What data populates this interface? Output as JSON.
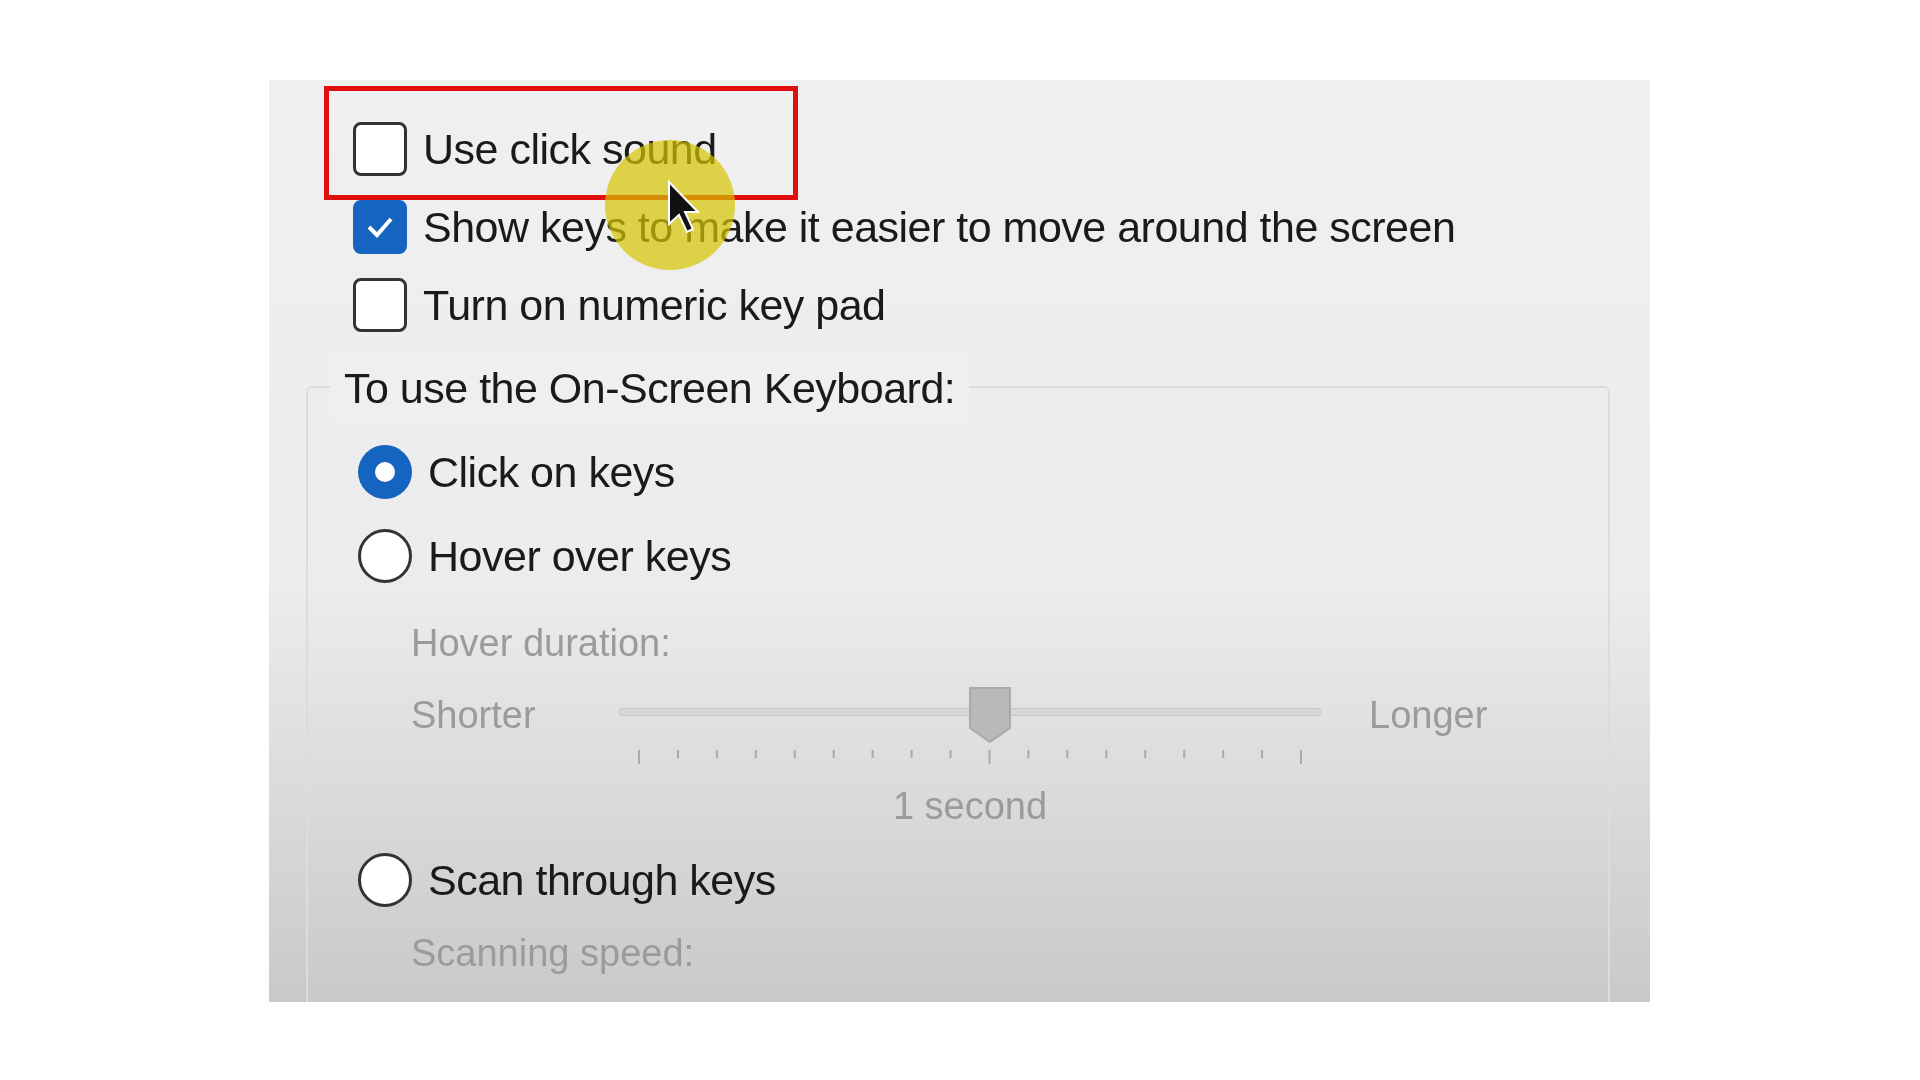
{
  "options": [
    {
      "label": "Use click sound",
      "checked": false
    },
    {
      "label": "Show keys to make it easier to move around the screen",
      "checked": true
    },
    {
      "label": "Turn on numeric key pad",
      "checked": false
    }
  ],
  "group": {
    "legend": "To use the On-Screen Keyboard:",
    "modes": [
      {
        "label": "Click on keys",
        "selected": true
      },
      {
        "label": "Hover over keys",
        "selected": false,
        "settings": {
          "kind": "slider",
          "label": "Hover duration:",
          "min_label": "Shorter",
          "max_label": "Longer",
          "level": 0.53,
          "reading": "1 second",
          "disabled": true
        }
      },
      {
        "label": "Scan through keys",
        "selected": false,
        "settings": {
          "kind": "label",
          "label": "Scanning speed:",
          "disabled": true
        }
      }
    ]
  }
}
